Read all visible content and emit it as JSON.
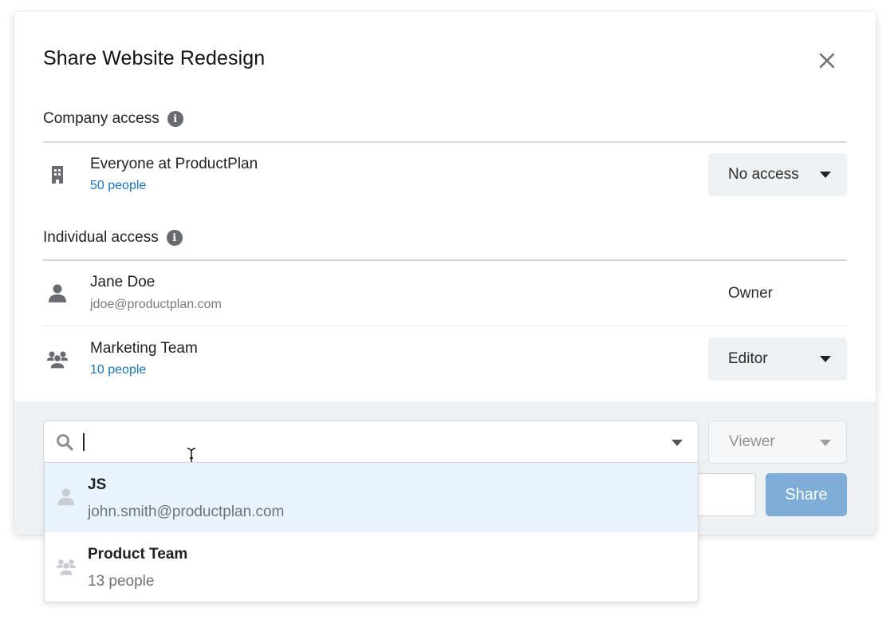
{
  "dialog": {
    "title": "Share Website Redesign",
    "close_icon": "close-icon"
  },
  "company_access": {
    "label": "Company access",
    "info_icon": "info-icon",
    "entry": {
      "icon": "building-icon",
      "name": "Everyone at ProductPlan",
      "sub": "50 people",
      "permission": "No access"
    }
  },
  "individual_access": {
    "label": "Individual access",
    "info_icon": "info-icon",
    "entries": [
      {
        "icon": "user-icon",
        "name": "Jane Doe",
        "sub": "jdoe@productplan.com",
        "permission": "Owner"
      },
      {
        "icon": "group-icon",
        "name": "Marketing Team",
        "sub": "10 people",
        "permission": "Editor"
      }
    ]
  },
  "add_people": {
    "search": {
      "icon": "search-icon",
      "value": "",
      "placeholder": ""
    },
    "role": "Viewer",
    "share_label": "Share",
    "suggestions": [
      {
        "icon": "user-icon",
        "name": "JS",
        "sub": "john.smith@productplan.com",
        "highlighted": true
      },
      {
        "icon": "group-icon",
        "name": "Product Team",
        "sub": "13 people",
        "highlighted": false
      }
    ]
  },
  "colors": {
    "link": "#1a73b8",
    "primary_disabled": "#7eaed7",
    "footer_bg": "#eef1f4",
    "highlight_bg": "#e9f3fd"
  }
}
